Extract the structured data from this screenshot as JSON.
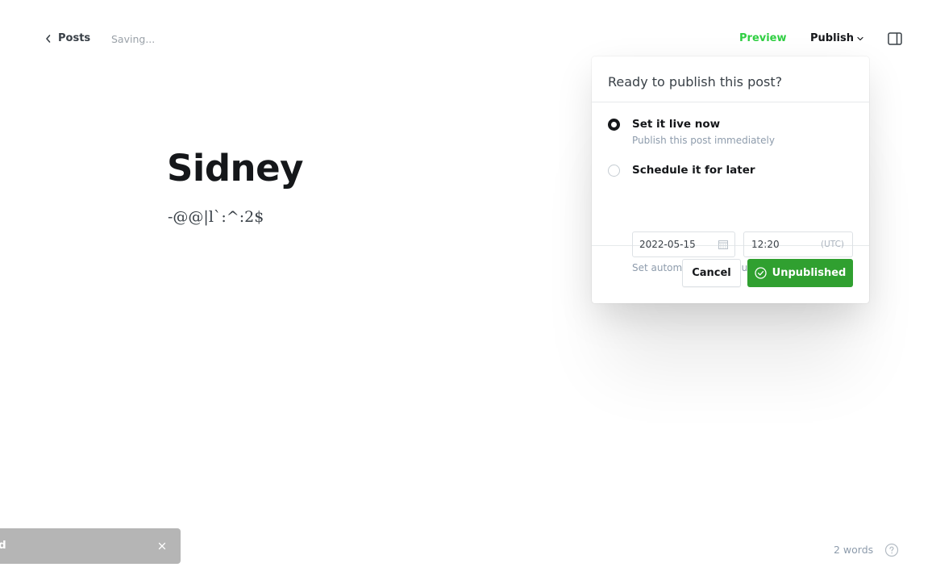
{
  "topbar": {
    "back_label": "Posts",
    "status": "Saving...",
    "preview_label": "Preview",
    "publish_label": "Publish"
  },
  "editor": {
    "title": "Sidney",
    "body": "-@@|l`:^:2$"
  },
  "publish_popover": {
    "title": "Ready to publish this post?",
    "options": [
      {
        "label": "Set it live now",
        "description": "Publish this post immediately",
        "selected": true
      },
      {
        "label": "Schedule it for later",
        "description": "",
        "selected": false
      }
    ],
    "date_value": "2022-05-15",
    "time_value": "12:20",
    "timezone": "(UTC)",
    "schedule_hint": "Set automatic future publish date",
    "cancel_label": "Cancel",
    "primary_label": "Unpublished"
  },
  "toast": {
    "text": "ved"
  },
  "footer": {
    "word_count": "2 words"
  },
  "colors": {
    "accent_green": "#30cf43",
    "button_green": "#30a030",
    "toast_bg": "#b5b5b5"
  },
  "icons": {
    "back": "chevron-left-icon",
    "publish_dropdown": "chevron-down-icon",
    "sidebar": "sidebar-toggle-icon",
    "calendar": "calendar-icon",
    "check": "check-circle-icon",
    "close": "close-icon",
    "help": "help-circle-icon"
  }
}
